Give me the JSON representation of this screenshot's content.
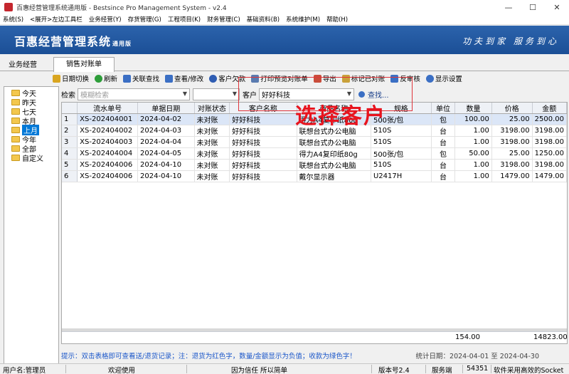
{
  "window": {
    "title": "百惠经营管理系统通用版 - Bestsince Pro Management System - v2.4",
    "minimize": "—",
    "maximize": "☐",
    "close": "✕"
  },
  "menu": [
    "系统(S)",
    "<展开>左边工具栏",
    "业务经营(Y)",
    "存货管理(G)",
    "工程项目(K)",
    "财务管理(C)",
    "基础资料(B)",
    "系统维护(M)",
    "帮助(H)"
  ],
  "banner": {
    "brand": "百惠经营管理系统",
    "edition": "通用版",
    "slogan": "功夫到家 服务到心"
  },
  "nav": {
    "main": "业务经营",
    "tab": "销售对账单"
  },
  "toolbar": [
    {
      "label": "日期切换",
      "icon": "calendar-icon",
      "color": "#d9a520"
    },
    {
      "label": "刷新",
      "icon": "refresh-icon",
      "color": "#2e9e3a"
    },
    {
      "label": "关联查找",
      "icon": "link-search-icon",
      "color": "#3b6fc4"
    },
    {
      "label": "查看/修改",
      "icon": "view-edit-icon",
      "color": "#3b6fc4"
    },
    {
      "label": "客户欠款",
      "icon": "customer-debt-icon",
      "color": "#2f5db3"
    },
    {
      "label": "打印预览对账单",
      "icon": "print-preview-icon",
      "color": "#5a7bb0"
    },
    {
      "label": "导出",
      "icon": "export-icon",
      "color": "#c94c3a"
    },
    {
      "label": "标记已对账",
      "icon": "mark-reconciled-icon",
      "color": "#c9a13a"
    },
    {
      "label": "反审核",
      "icon": "unaudit-icon",
      "color": "#3b6fc4"
    },
    {
      "label": "显示设置",
      "icon": "display-settings-icon",
      "color": "#3b6fc4"
    }
  ],
  "tree": [
    {
      "label": "今天",
      "selected": false
    },
    {
      "label": "昨天",
      "selected": false
    },
    {
      "label": "七天",
      "selected": false
    },
    {
      "label": "本月",
      "selected": false
    },
    {
      "label": "上月",
      "selected": true
    },
    {
      "label": "今年",
      "selected": false
    },
    {
      "label": "全部",
      "selected": false
    },
    {
      "label": "自定义",
      "selected": false
    }
  ],
  "filter": {
    "search_label": "检索",
    "search_placeholder": "模糊检索",
    "customer_label": "客户",
    "customer_value": "好好科技",
    "search_button": "查找..."
  },
  "grid": {
    "columns": [
      "流水单号",
      "单据日期",
      "对账状态",
      "客户名称",
      "商品名称",
      "规格",
      "单位",
      "数量",
      "价格",
      "金额"
    ],
    "rows": [
      [
        "1",
        "XS-202404001",
        "2024-04-02",
        "未对账",
        "好好科技",
        "得力A4复印纸80g",
        "500张/包",
        "包",
        "100.00",
        "25.00",
        "2500.00"
      ],
      [
        "2",
        "XS-202404002",
        "2024-04-03",
        "未对账",
        "好好科技",
        "联想台式办公电脑",
        "510S",
        "台",
        "1.00",
        "3198.00",
        "3198.00"
      ],
      [
        "3",
        "XS-202404003",
        "2024-04-04",
        "未对账",
        "好好科技",
        "联想台式办公电脑",
        "510S",
        "台",
        "1.00",
        "3198.00",
        "3198.00"
      ],
      [
        "4",
        "XS-202404004",
        "2024-04-05",
        "未对账",
        "好好科技",
        "得力A4复印纸80g",
        "500张/包",
        "包",
        "50.00",
        "25.00",
        "1250.00"
      ],
      [
        "5",
        "XS-202404006",
        "2024-04-10",
        "未对账",
        "好好科技",
        "联想台式办公电脑",
        "510S",
        "台",
        "1.00",
        "3198.00",
        "3198.00"
      ],
      [
        "6",
        "XS-202404006",
        "2024-04-10",
        "未对账",
        "好好科技",
        "戴尔显示器",
        "U2417H",
        "台",
        "1.00",
        "1479.00",
        "1479.00"
      ]
    ],
    "total_qty": "154.00",
    "total_amount": "14823.00"
  },
  "annotation": "选择客户",
  "hint": "提示：双击表格即可查看送/退货记录；注：退货为红色字，数量/金额显示为负值；收款为绿色字！",
  "stat_date": "统计日期：2024-04-01 至 2024-04-30",
  "status": {
    "user": "用户名:管理员",
    "welcome": "欢迎使用",
    "motto": "因为信任 所以简单",
    "version": "版本号2.4",
    "server": "服务端",
    "port": "54351",
    "socket": "软件采用高效的Socket"
  }
}
